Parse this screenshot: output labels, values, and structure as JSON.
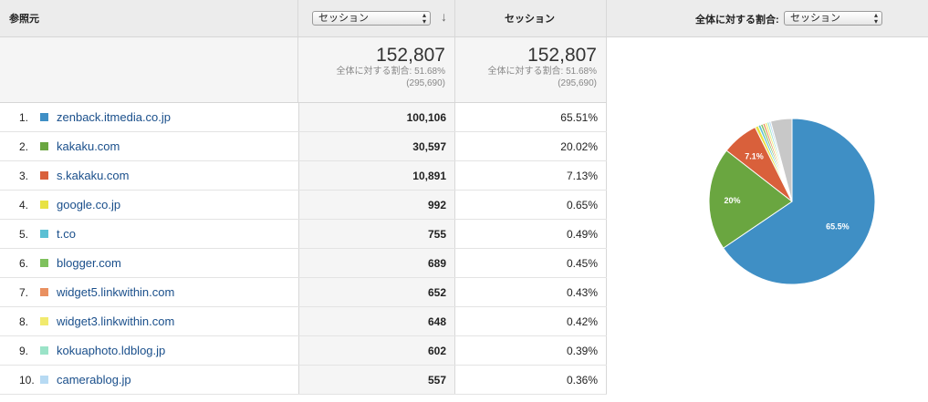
{
  "header": {
    "referrer_label": "参照元",
    "metric_select": "セッション",
    "sessions_label": "セッション",
    "ratio_label": "全体に対する割合:",
    "pie_select": "セッション"
  },
  "totals": {
    "primary": {
      "value": "152,807",
      "ratio": "全体に対する割合: 51.68%",
      "total": "(295,690)"
    },
    "secondary": {
      "value": "152,807",
      "ratio": "全体に対する割合: 51.68%",
      "total": "(295,690)"
    }
  },
  "rows": [
    {
      "index": "1.",
      "name": "zenback.itmedia.co.jp",
      "sessions": "100,106",
      "percent": "65.51%",
      "color": "#3f8fc5"
    },
    {
      "index": "2.",
      "name": "kakaku.com",
      "sessions": "30,597",
      "percent": "20.02%",
      "color": "#6aa640"
    },
    {
      "index": "3.",
      "name": "s.kakaku.com",
      "sessions": "10,891",
      "percent": "7.13%",
      "color": "#d9603b"
    },
    {
      "index": "4.",
      "name": "google.co.jp",
      "sessions": "992",
      "percent": "0.65%",
      "color": "#e8e243"
    },
    {
      "index": "5.",
      "name": "t.co",
      "sessions": "755",
      "percent": "0.49%",
      "color": "#5bc0d4"
    },
    {
      "index": "6.",
      "name": "blogger.com",
      "sessions": "689",
      "percent": "0.45%",
      "color": "#7fc15d"
    },
    {
      "index": "7.",
      "name": "widget5.linkwithin.com",
      "sessions": "652",
      "percent": "0.43%",
      "color": "#e99060"
    },
    {
      "index": "8.",
      "name": "widget3.linkwithin.com",
      "sessions": "648",
      "percent": "0.42%",
      "color": "#f1ea6e"
    },
    {
      "index": "9.",
      "name": "kokuaphoto.ldblog.jp",
      "sessions": "602",
      "percent": "0.39%",
      "color": "#9be3c8"
    },
    {
      "index": "10.",
      "name": "camerablog.jp",
      "sessions": "557",
      "percent": "0.36%",
      "color": "#b7daf3"
    }
  ],
  "chart_data": {
    "type": "pie",
    "categories": [
      "zenback.itmedia.co.jp",
      "kakaku.com",
      "s.kakaku.com",
      "google.co.jp",
      "t.co",
      "blogger.com",
      "widget5.linkwithin.com",
      "widget3.linkwithin.com",
      "kokuaphoto.ldblog.jp",
      "camerablog.jp",
      "other"
    ],
    "values": [
      65.51,
      20.02,
      7.13,
      0.65,
      0.49,
      0.45,
      0.43,
      0.42,
      0.39,
      0.36,
      4.15
    ],
    "colors": [
      "#3f8fc5",
      "#6aa640",
      "#d9603b",
      "#e8e243",
      "#5bc0d4",
      "#7fc15d",
      "#e99060",
      "#f1ea6e",
      "#9be3c8",
      "#b7daf3",
      "#c8c8c8"
    ],
    "slice_labels": [
      "65.5%",
      "20%",
      "7.1%",
      "",
      "",
      "",
      "",
      "",
      "",
      "",
      ""
    ]
  }
}
